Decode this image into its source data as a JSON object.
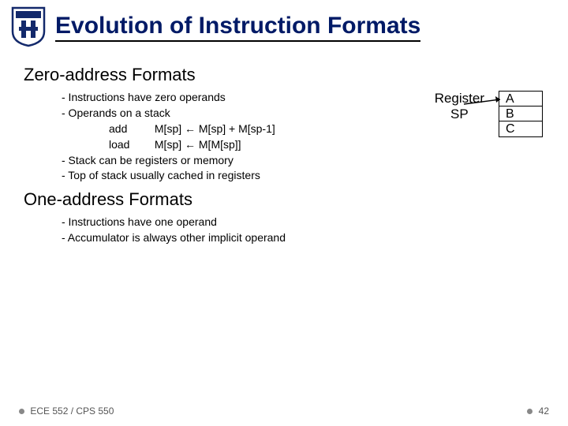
{
  "title": "Evolution of Instruction Formats",
  "sections": {
    "zero": {
      "heading": "Zero-address Formats",
      "b1": "- Instructions have zero operands",
      "b2": "- Operands on a stack",
      "op1m": "add",
      "op1e": "M[sp] ← M[sp] + M[sp-1]",
      "op2m": "load",
      "op2e": "M[sp] ← M[M[sp]]",
      "b3": "- Stack can be registers or memory",
      "b4": "- Top of stack usually cached in registers"
    },
    "one": {
      "heading": "One-address Formats",
      "b1": "- Instructions have one operand",
      "b2": "- Accumulator is always other implicit operand"
    }
  },
  "diagram": {
    "label1": "Register",
    "label2": "SP",
    "cells": {
      "a": "A",
      "b": "B",
      "c": "C"
    }
  },
  "footer": {
    "left": "ECE 552 / CPS 550",
    "right": "42"
  }
}
